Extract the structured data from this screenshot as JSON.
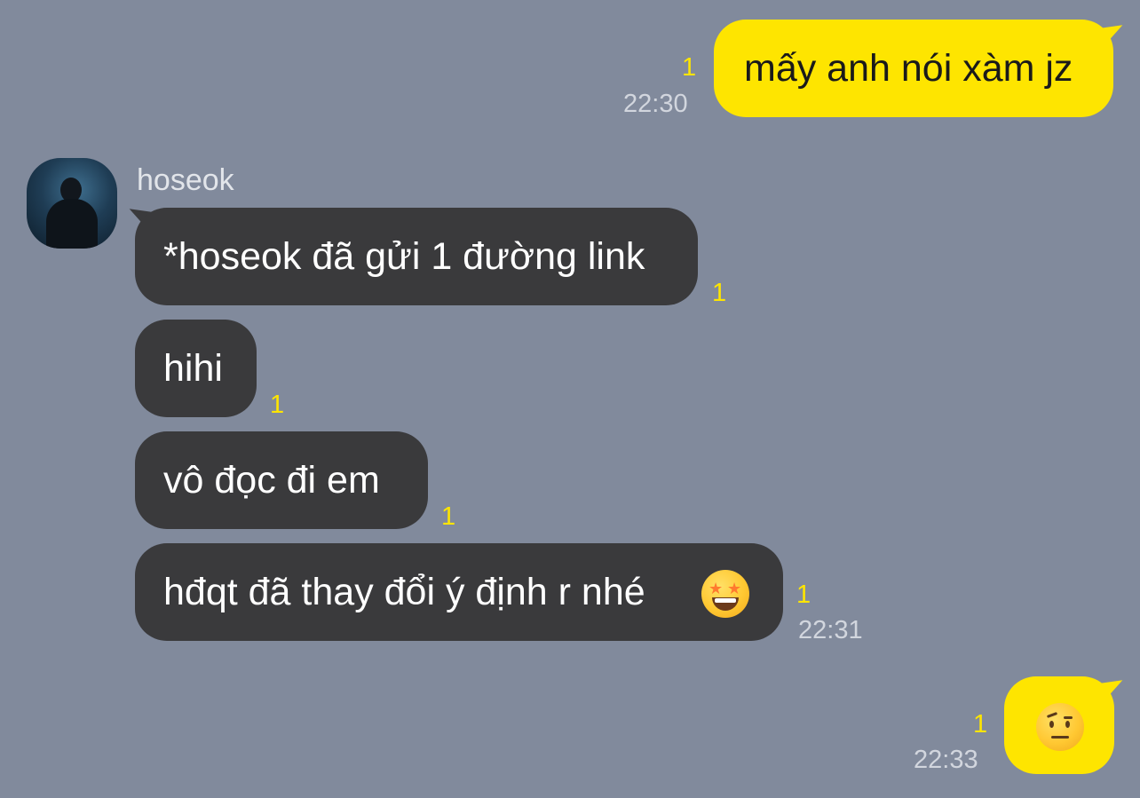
{
  "contact": {
    "name": "hoseok"
  },
  "messages": [
    {
      "id": "m1",
      "direction": "outgoing",
      "text": "mấy anh nói xàm jz",
      "unread": "1",
      "time": "22:30"
    },
    {
      "id": "m2",
      "direction": "incoming",
      "text": "*hoseok đã gửi 1 đường link",
      "unread": "1",
      "time": ""
    },
    {
      "id": "m3",
      "direction": "incoming",
      "text": "hihi",
      "unread": "1",
      "time": ""
    },
    {
      "id": "m4",
      "direction": "incoming",
      "text": "vô đọc đi em",
      "unread": "1",
      "time": ""
    },
    {
      "id": "m5",
      "direction": "incoming",
      "text": "hđqt đã thay đổi ý định r nhé",
      "emoji": "star-struck-emoji",
      "unread": "1",
      "time": "22:31"
    },
    {
      "id": "m6",
      "direction": "outgoing",
      "text": "",
      "emoji": "face-with-raised-eyebrow-emoji",
      "unread": "1",
      "time": "22:33"
    }
  ],
  "colors": {
    "background": "#818a9c",
    "outgoing_bubble": "#fee500",
    "incoming_bubble": "#3a3a3c",
    "unread_count": "#fee500",
    "timestamp": "#d2d6de"
  }
}
